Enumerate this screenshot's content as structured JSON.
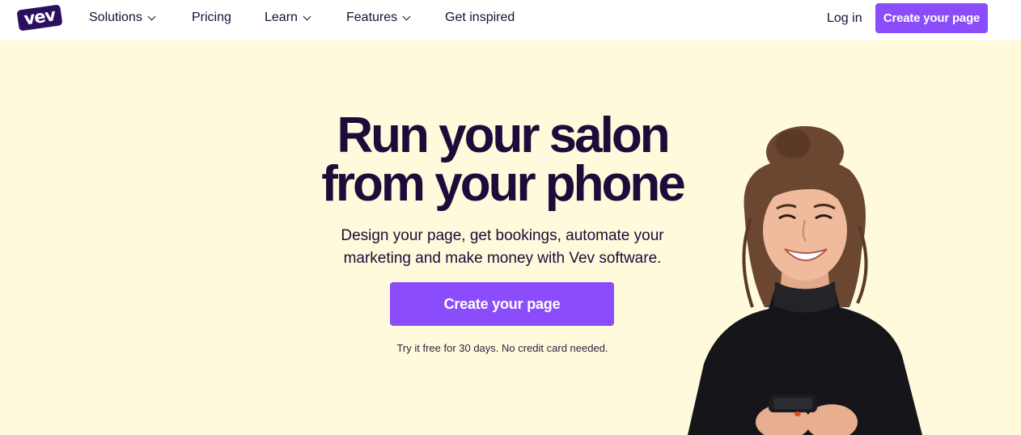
{
  "brand": {
    "logo_text": "vev",
    "color": "#2a0f5e"
  },
  "nav": {
    "items": [
      {
        "label": "Solutions",
        "has_dropdown": true
      },
      {
        "label": "Pricing",
        "has_dropdown": false
      },
      {
        "label": "Learn",
        "has_dropdown": true
      },
      {
        "label": "Features",
        "has_dropdown": true
      },
      {
        "label": "Get inspired",
        "has_dropdown": false
      }
    ],
    "login_label": "Log in",
    "cta_label": "Create your page"
  },
  "hero": {
    "title_line1": "Run your salon",
    "title_line2": "from your phone",
    "subtitle_line1": "Design your page, get bookings, automate your",
    "subtitle_line2": "marketing and make money with Vev software.",
    "cta_label": "Create your page",
    "note": "Try it free for 30 days. No credit card needed."
  },
  "colors": {
    "accent": "#8b4dfb",
    "background": "#fffadb",
    "text": "#1a0d3a"
  },
  "icons": {
    "dropdown": "chevron-down-icon"
  }
}
